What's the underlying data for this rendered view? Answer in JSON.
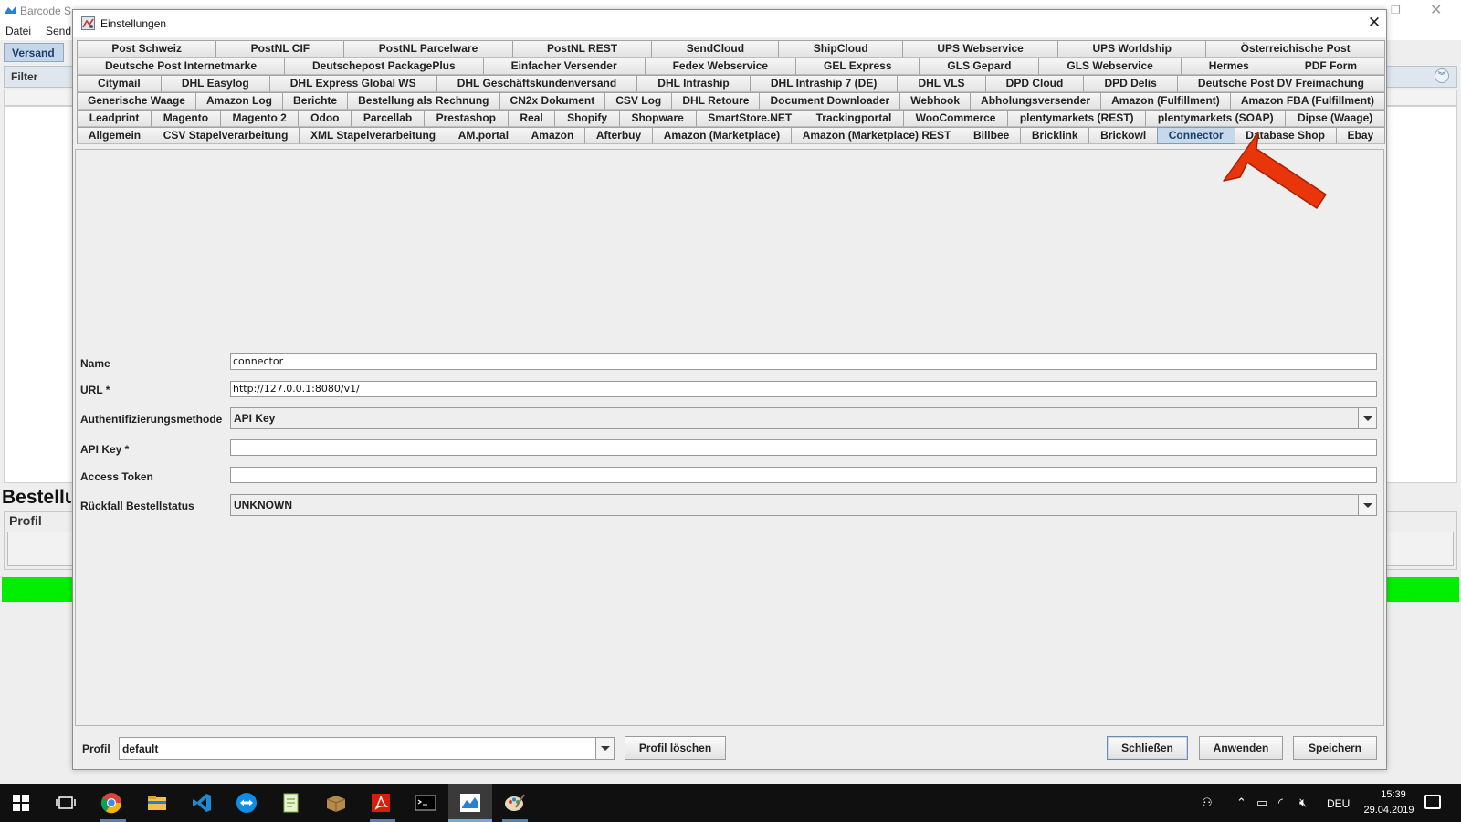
{
  "background_app": {
    "title": "Barcode Shipping",
    "menu": [
      "Datei",
      "Send"
    ],
    "tab": "Versand",
    "filter_label": "Filter",
    "section_heading": "Bestellungen",
    "profil_group_label": "Profil",
    "status_color": "#00ee00"
  },
  "dialog": {
    "title": "Einstellungen",
    "close_glyph": "✕",
    "tab_rows": [
      [
        "Post Schweiz",
        "PostNL CIF",
        "PostNL Parcelware",
        "PostNL REST",
        "SendCloud",
        "ShipCloud",
        "UPS Webservice",
        "UPS Worldship",
        "Österreichische Post"
      ],
      [
        "Deutsche Post Internetmarke",
        "Deutschepost PackagePlus",
        "Einfacher Versender",
        "Fedex Webservice",
        "GEL Express",
        "GLS Gepard",
        "GLS Webservice",
        "Hermes",
        "PDF Form"
      ],
      [
        "Citymail",
        "DHL Easylog",
        "DHL Express Global WS",
        "DHL Geschäftskundenversand",
        "DHL Intraship",
        "DHL Intraship 7 (DE)",
        "DHL VLS",
        "DPD Cloud",
        "DPD Delis",
        "Deutsche Post DV Freimachung"
      ],
      [
        "Generische Waage",
        "Amazon Log",
        "Berichte",
        "Bestellung als Rechnung",
        "CN2x Dokument",
        "CSV Log",
        "DHL Retoure",
        "Document Downloader",
        "Webhook",
        "Abholungsversender",
        "Amazon (Fulfillment)",
        "Amazon FBA (Fulfillment)"
      ],
      [
        "Leadprint",
        "Magento",
        "Magento 2",
        "Odoo",
        "Parcellab",
        "Prestashop",
        "Real",
        "Shopify",
        "Shopware",
        "SmartStore.NET",
        "Trackingportal",
        "WooCommerce",
        "plentymarkets (REST)",
        "plentymarkets (SOAP)",
        "Dipse (Waage)"
      ],
      [
        "Allgemein",
        "CSV Stapelverarbeitung",
        "XML Stapelverarbeitung",
        "AM.portal",
        "Amazon",
        "Afterbuy",
        "Amazon (Marketplace)",
        "Amazon (Marketplace) REST",
        "Billbee",
        "Bricklink",
        "Brickowl",
        "Connector",
        "Database Shop",
        "Ebay"
      ]
    ],
    "selected_tab": "Connector",
    "form": {
      "name_label": "Name",
      "name_value": "connector",
      "url_label": "URL *",
      "url_value": "http://127.0.0.1:8080/v1/",
      "auth_label": "Authentifizierungsmethode",
      "auth_value": "API Key",
      "apikey_label": "API Key *",
      "apikey_value": "",
      "token_label": "Access Token",
      "token_value": "",
      "fallback_label": "Rückfall Bestellstatus",
      "fallback_value": "UNKNOWN"
    },
    "footer": {
      "profil_label": "Profil",
      "profil_value": "default",
      "delete_profile": "Profil löschen",
      "close": "Schließen",
      "apply": "Anwenden",
      "save": "Speichern"
    }
  },
  "annotation": {
    "arrow_color": "#e8350a"
  },
  "taskbar": {
    "apps": [
      "windows-start-icon",
      "task-view-icon",
      "chrome-icon",
      "file-explorer-icon",
      "vscode-icon",
      "teamviewer-icon",
      "notepad-plus-plus-icon",
      "package-icon",
      "acrobat-icon",
      "terminal-icon",
      "barcode-shipping-icon",
      "paint-icon"
    ],
    "lang": "DEU",
    "time": "15:39",
    "date": "29.04.2019"
  }
}
